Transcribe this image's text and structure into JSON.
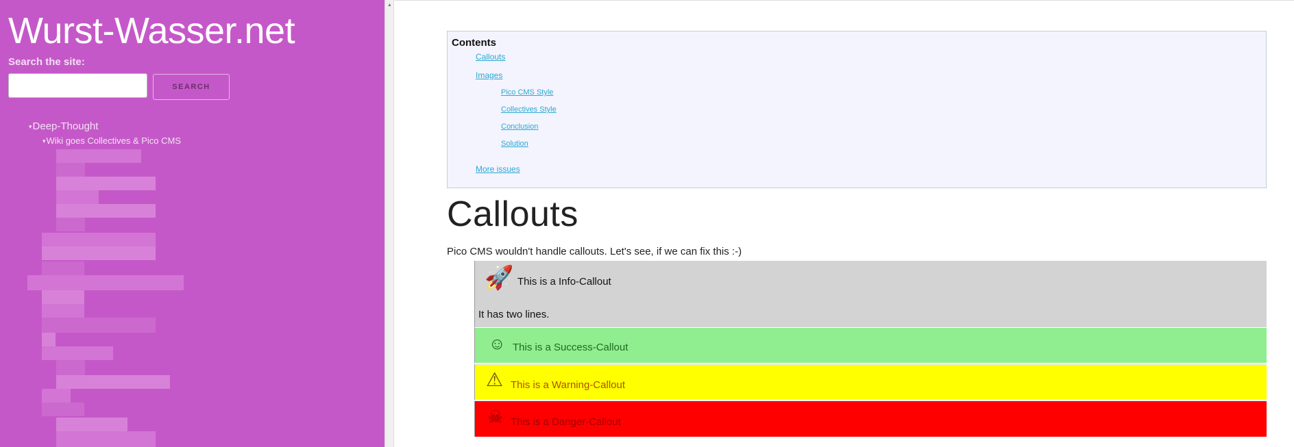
{
  "sidebar": {
    "site_title": "Wurst-Wasser.net",
    "search_label": "Search the site:",
    "search_value": "",
    "search_button": "Search",
    "tree": [
      {
        "label": "Deep-Thought",
        "caret": "▾"
      },
      {
        "label": "Wiki goes Collectives & Pico CMS",
        "caret": "▾"
      }
    ],
    "accent_color": "#c558c8"
  },
  "toc": {
    "title": "Contents",
    "items": [
      {
        "label": "Callouts",
        "level": 1
      },
      {
        "label": "Images",
        "level": 1
      },
      {
        "label": "Pico CMS Style",
        "level": 2
      },
      {
        "label": "Collectives Style",
        "level": 2
      },
      {
        "label": "Conclusion",
        "level": 2
      },
      {
        "label": "Solution",
        "level": 2
      },
      {
        "label": "More issues",
        "level": 1
      }
    ]
  },
  "main": {
    "heading": "Callouts",
    "intro": "Pico CMS wouldn't handle callouts. Let's see, if we can fix this :-)"
  },
  "callouts": {
    "info": {
      "icon": "rocket-icon",
      "glyph": "🚀",
      "title": "This is a Info-Callout",
      "line2": "It has two lines.",
      "color": "#d3d3d3"
    },
    "success": {
      "icon": "smile-icon",
      "glyph": "☺",
      "title": "This is a Success-Callout",
      "color": "#90ee90"
    },
    "warning": {
      "icon": "warning-icon",
      "glyph": "⚠",
      "title": "This is a Warning-Callout",
      "color": "#ffff00"
    },
    "danger": {
      "icon": "skull-icon",
      "glyph": "☠",
      "title": "This is a Danger-Callout",
      "color": "#ff0000"
    }
  }
}
